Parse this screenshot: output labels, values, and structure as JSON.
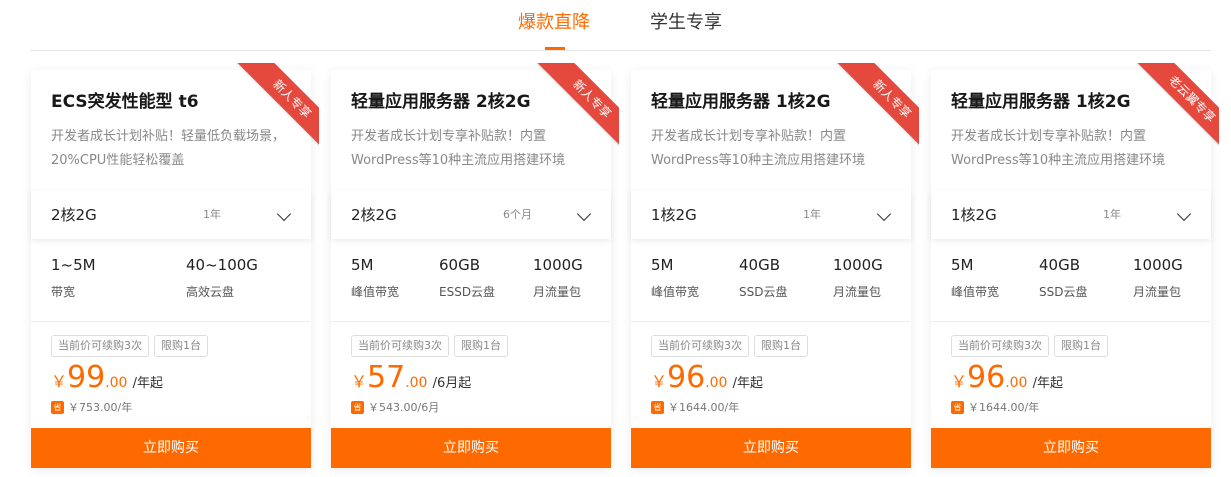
{
  "tabs": [
    {
      "label": "爆款直降",
      "active": true
    },
    {
      "label": "学生专享",
      "active": false
    }
  ],
  "colors": {
    "accent": "#ff6a00",
    "ribbon": "#e5483c"
  },
  "cards": [
    {
      "title": "ECS突发性能型 t6",
      "ribbon": "新人专享",
      "desc": "开发者成长计划补贴！轻量低负载场景，20%CPU性能轻松覆盖",
      "spec": "2核2G",
      "term": "1年",
      "features": [
        {
          "value": "1~5M",
          "label": "带宽"
        },
        {
          "value": "40~100G",
          "label": "高效云盘"
        }
      ],
      "tags": [
        "当前价可续购3次",
        "限购1台"
      ],
      "currency": "￥",
      "price_int": "99",
      "price_dec": ".00",
      "price_unit": "/年起",
      "save_icon": "省",
      "original": "￥753.00/年",
      "buy": "立即购买"
    },
    {
      "title": "轻量应用服务器 2核2G",
      "ribbon": "新人专享",
      "desc": "开发者成长计划专享补贴款！内置WordPress等10种主流应用搭建环境",
      "spec": "2核2G",
      "term": "6个月",
      "features": [
        {
          "value": "5M",
          "label": "峰值带宽"
        },
        {
          "value": "60GB",
          "label": "ESSD云盘"
        },
        {
          "value": "1000G",
          "label": "月流量包"
        }
      ],
      "tags": [
        "当前价可续购3次",
        "限购1台"
      ],
      "currency": "￥",
      "price_int": "57",
      "price_dec": ".00",
      "price_unit": "/6月起",
      "save_icon": "省",
      "original": "￥543.00/6月",
      "buy": "立即购买"
    },
    {
      "title": "轻量应用服务器 1核2G",
      "ribbon": "新人专享",
      "desc": "开发者成长计划专享补贴款！内置WordPress等10种主流应用搭建环境",
      "spec": "1核2G",
      "term": "1年",
      "features": [
        {
          "value": "5M",
          "label": "峰值带宽"
        },
        {
          "value": "40GB",
          "label": "SSD云盘"
        },
        {
          "value": "1000G",
          "label": "月流量包"
        }
      ],
      "tags": [
        "当前价可续购3次",
        "限购1台"
      ],
      "currency": "￥",
      "price_int": "96",
      "price_dec": ".00",
      "price_unit": "/年起",
      "save_icon": "省",
      "original": "￥1644.00/年",
      "buy": "立即购买"
    },
    {
      "title": "轻量应用服务器 1核2G",
      "ribbon": "老云翼专享",
      "desc": "开发者成长计划专享补贴款！内置WordPress等10种主流应用搭建环境",
      "spec": "1核2G",
      "term": "1年",
      "features": [
        {
          "value": "5M",
          "label": "峰值带宽"
        },
        {
          "value": "40GB",
          "label": "SSD云盘"
        },
        {
          "value": "1000G",
          "label": "月流量包"
        }
      ],
      "tags": [
        "当前价可续购3次",
        "限购1台"
      ],
      "currency": "￥",
      "price_int": "96",
      "price_dec": ".00",
      "price_unit": "/年起",
      "save_icon": "省",
      "original": "￥1644.00/年",
      "buy": "立即购买"
    }
  ]
}
